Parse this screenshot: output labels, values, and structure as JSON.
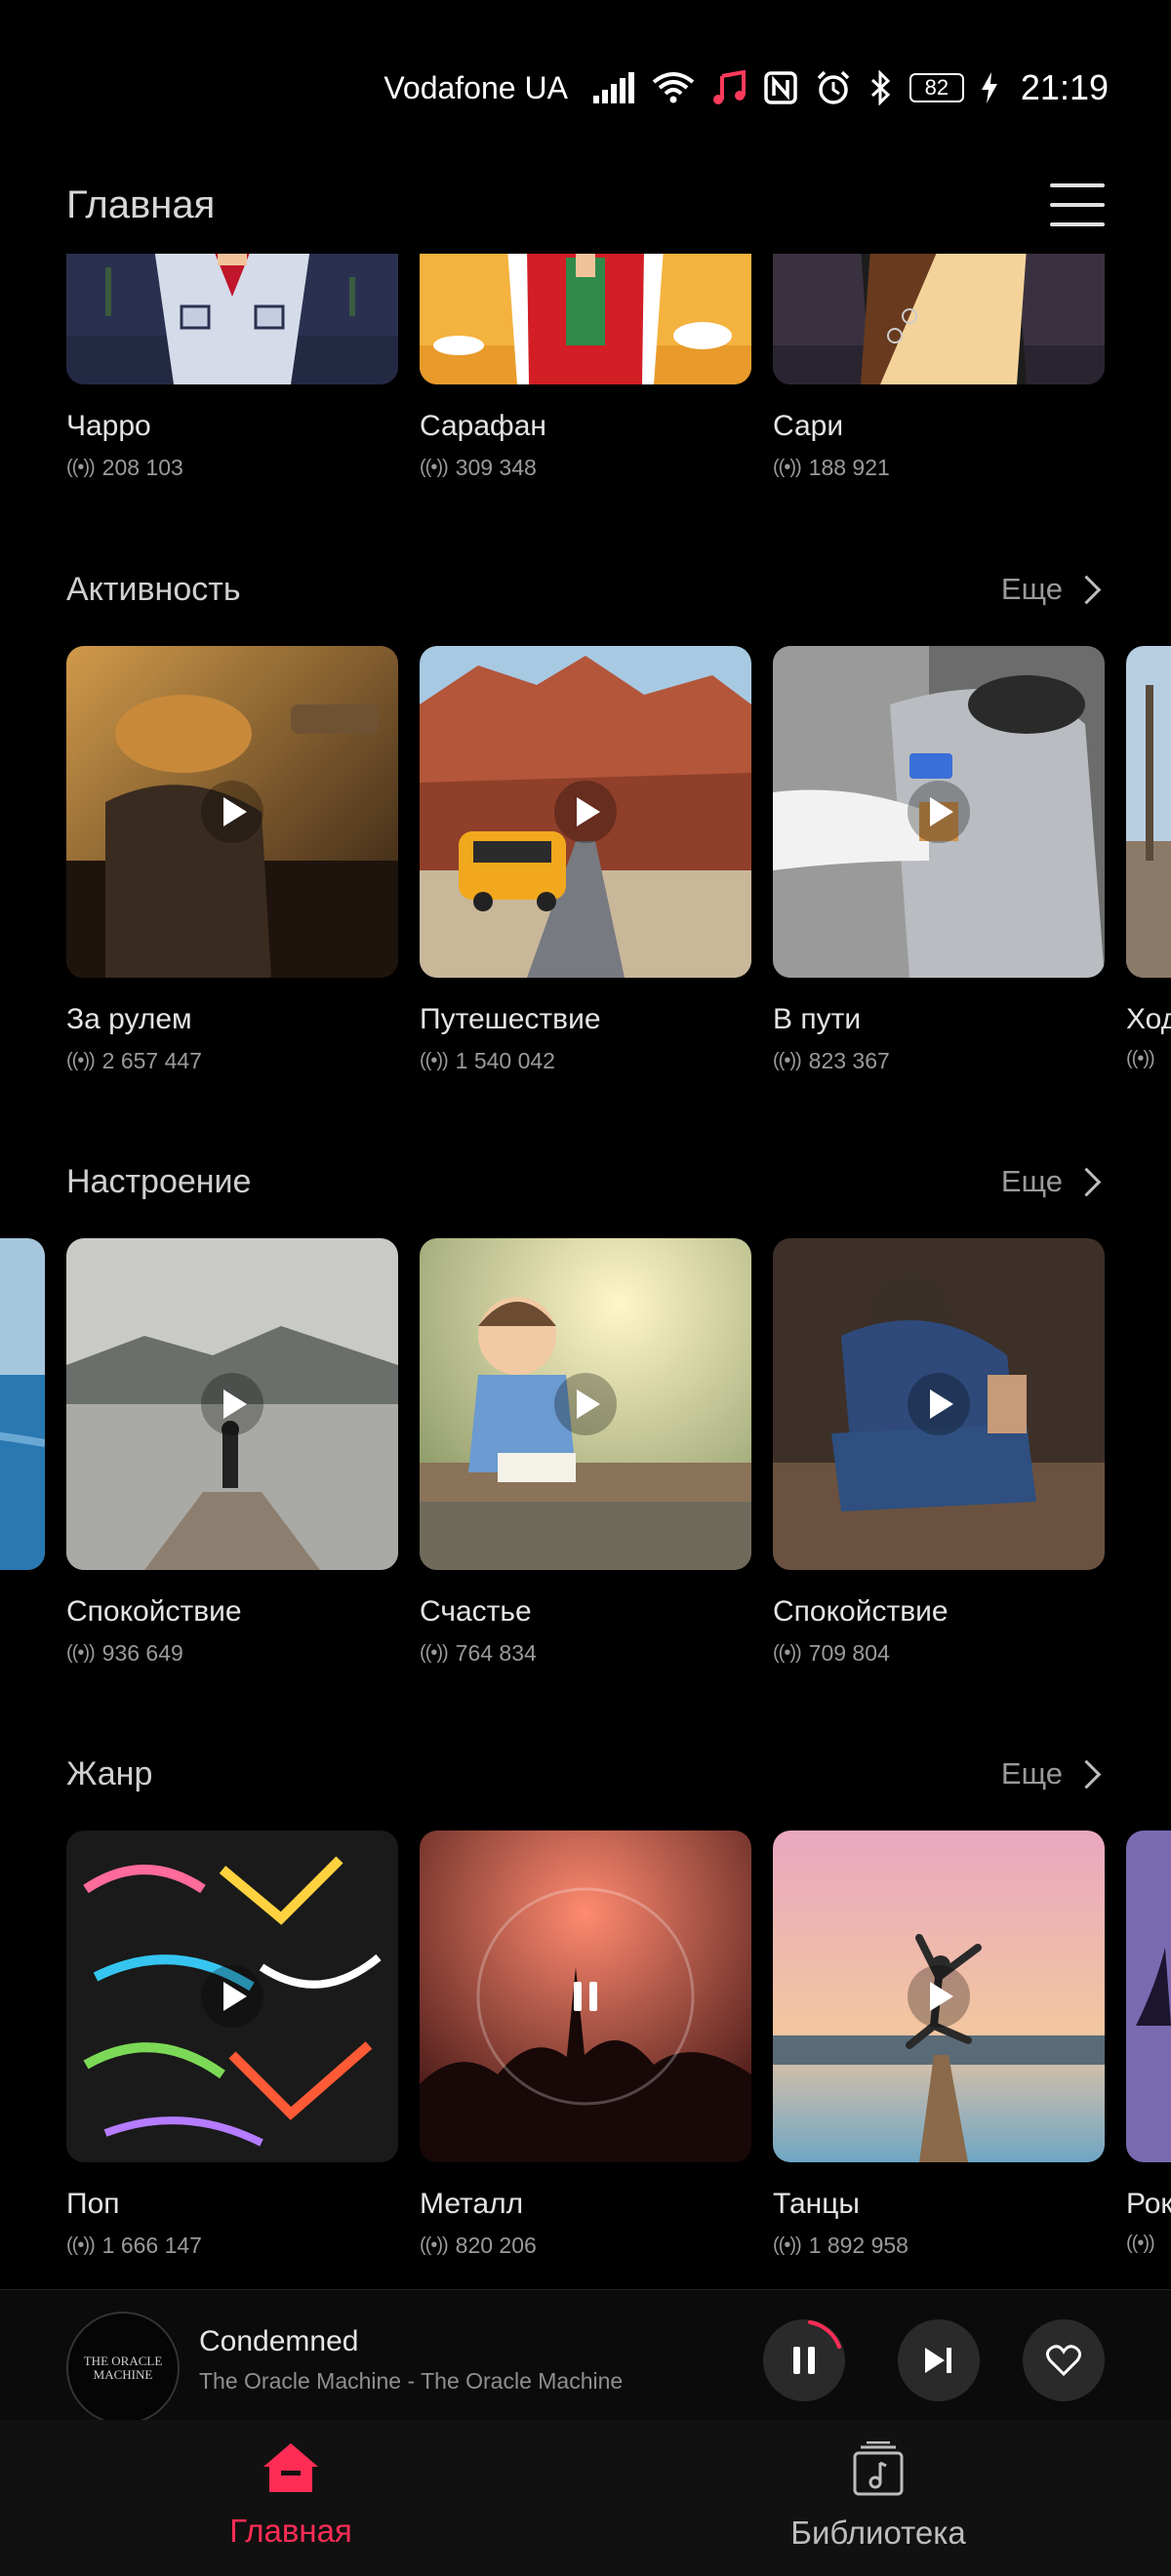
{
  "status": {
    "carrier": "Vodafone UA",
    "battery": "82",
    "time": "21:19"
  },
  "header": {
    "title": "Главная"
  },
  "top_row": [
    {
      "title": "Чарро",
      "count": "208 103"
    },
    {
      "title": "Сарафан",
      "count": "309 348"
    },
    {
      "title": "Сари",
      "count": "188 921"
    }
  ],
  "sections": [
    {
      "title": "Активность",
      "more": "Еще",
      "items": [
        {
          "title": "За рулем",
          "count": "2 657 447"
        },
        {
          "title": "Путешествие",
          "count": "1 540 042"
        },
        {
          "title": "В пути",
          "count": "823 367"
        },
        {
          "title": "Ход",
          "count": ""
        }
      ]
    },
    {
      "title": "Настроение",
      "more": "Еще",
      "items": [
        {
          "title": "Спокойствие",
          "count": "936 649"
        },
        {
          "title": "Счастье",
          "count": "764 834"
        },
        {
          "title": "Спокойствие",
          "count": "709 804"
        }
      ]
    },
    {
      "title": "Жанр",
      "more": "Еще",
      "items": [
        {
          "title": "Поп",
          "count": "1 666 147"
        },
        {
          "title": "Металл",
          "count": "820 206"
        },
        {
          "title": "Танцы",
          "count": "1 892 958"
        },
        {
          "title": "Рок",
          "count": ""
        }
      ]
    }
  ],
  "player": {
    "album_art_text": "THE ORACLE MACHINE",
    "track_title": "Condemned",
    "track_subtitle": "The Oracle Machine - The Oracle Machine"
  },
  "nav": {
    "home_label": "Главная",
    "library_label": "Библиотека"
  },
  "colors": {
    "accent": "#ff2d55",
    "background": "#000000"
  }
}
